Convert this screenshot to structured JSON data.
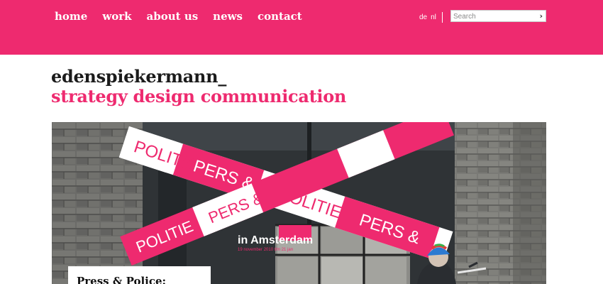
{
  "nav": {
    "items": [
      {
        "label": "home"
      },
      {
        "label": "work"
      },
      {
        "label": "about us"
      },
      {
        "label": "news"
      },
      {
        "label": "contact"
      }
    ]
  },
  "lang": {
    "de": "de",
    "nl": "nl"
  },
  "search": {
    "placeholder": "Search",
    "go_icon": "chevron-right-icon"
  },
  "brand": {
    "name": "edenspiekermann_",
    "tagline": "strategy design communication"
  },
  "hero": {
    "tape_texts": [
      "POLITIE",
      "PERS &",
      "POLITIE",
      "PERS &",
      "POLITIE",
      "PERS &"
    ],
    "window_title": "in Amsterdam",
    "window_subtitle": "19 november 2010 t/m 21 jan",
    "caption": "Press & Police:"
  },
  "colors": {
    "brand": "#ee2a6f",
    "text": "#1b1b1b"
  }
}
